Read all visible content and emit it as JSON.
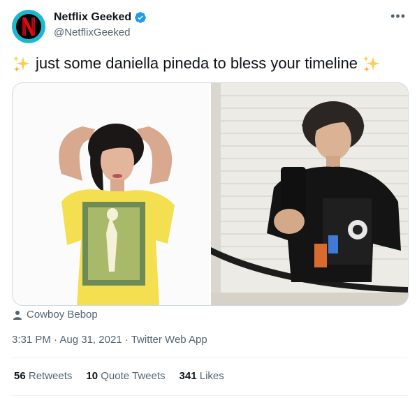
{
  "account": {
    "display_name": "Netflix Geeked",
    "handle": "@NetflixGeeked",
    "verified": true,
    "avatar_letter": "N",
    "avatar_color": "#1fb6d0"
  },
  "tweet": {
    "text": "just some daniella pineda to bless your timeline",
    "emoji": "sparkles"
  },
  "media_tag": "Cowboy Bebop",
  "meta": {
    "time": "3:31 PM",
    "date": "Aug 31, 2021",
    "source": "Twitter Web App",
    "sep": "·"
  },
  "stats": {
    "retweets_count": "56",
    "retweets_label": "Retweets",
    "quotes_count": "10",
    "quotes_label": "Quote Tweets",
    "likes_count": "341",
    "likes_label": "Likes"
  },
  "colors": {
    "verified": "#1d9bf0",
    "netflix_red": "#e50914",
    "text_secondary": "#536471"
  }
}
